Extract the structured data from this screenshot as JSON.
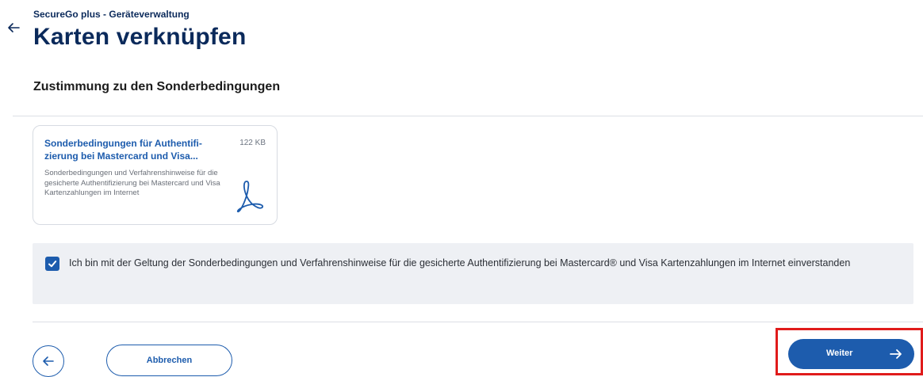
{
  "header": {
    "app_subtitle": "SecureGo plus - Geräteverwaltung",
    "title": "Karten verknüpfen"
  },
  "section": {
    "heading": "Zustimmung zu den Sonderbedingungen"
  },
  "document": {
    "title": "Sonderbedingungen für Authentifi-zierung bei Mastercard und Visa...",
    "size": "122 KB",
    "description": "Sonderbedingungen und Verfahrenshinweise für die gesicherte Authentifizierung bei Mastercard und Visa Kartenzahlungen im Internet",
    "icon": "pdf-icon"
  },
  "consent": {
    "checked": true,
    "text": "Ich bin mit der Geltung der Sonderbedingungen und Verfahrenshinweise für die gesicherte Authentifizierung bei Mastercard® und Visa Kartenzahlungen im Internet einverstanden"
  },
  "actions": {
    "cancel_label": "Abbrechen",
    "next_label": "Weiter"
  },
  "colors": {
    "primary": "#1d5cad",
    "title": "#0b2a5b",
    "highlight": "#e01b1b",
    "consent_bg": "#eef0f4"
  }
}
